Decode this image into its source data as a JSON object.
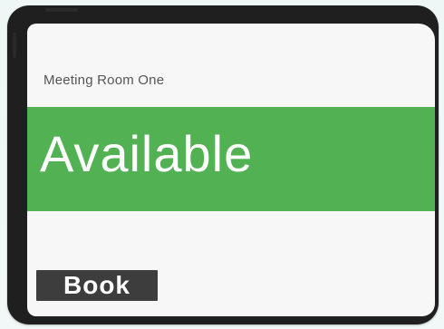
{
  "room": {
    "name": "Meeting Room One"
  },
  "status": {
    "label": "Available",
    "color": "#52b153"
  },
  "actions": {
    "book_label": "Book"
  },
  "colors": {
    "bezel": "#1f1f1f",
    "screen": "#f7f7f7",
    "button": "#3d3d3d"
  }
}
